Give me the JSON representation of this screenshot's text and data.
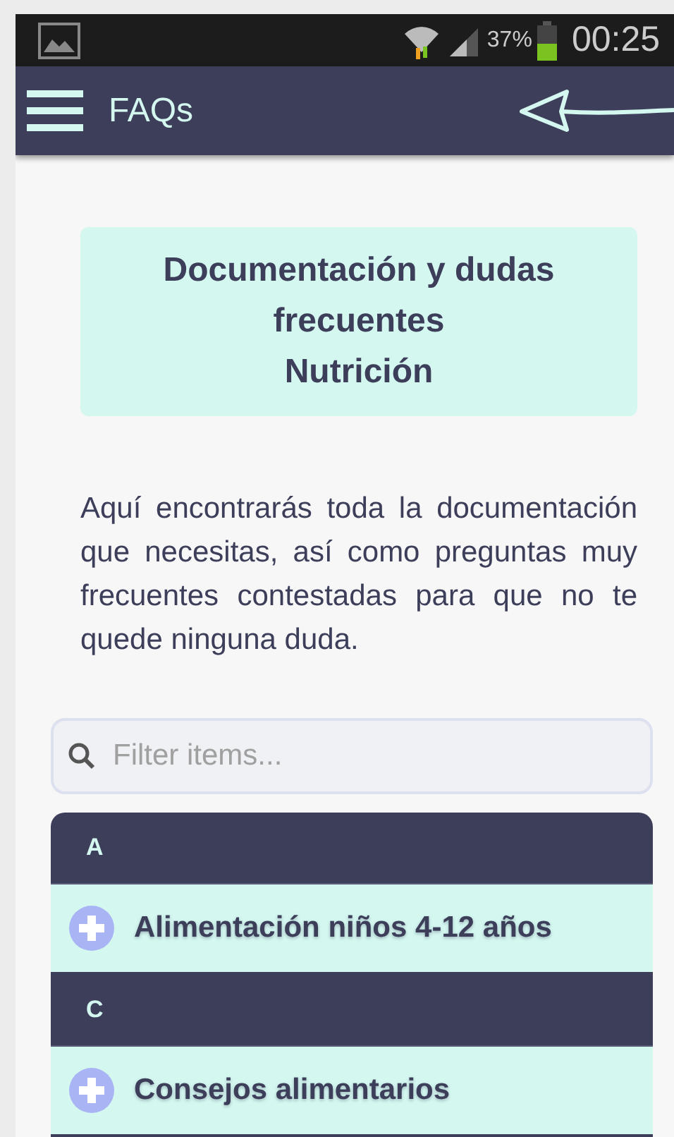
{
  "status_bar": {
    "battery": "37%",
    "time": "00:25"
  },
  "app_bar": {
    "title": "FAQs"
  },
  "intro_card": {
    "lines": [
      "Documentación y dudas frecuentes",
      "Nutrición"
    ]
  },
  "description": "Aquí encontrarás toda la documentación que necesitas, así como preguntas muy frecuentes contestadas para que no te quede ninguna duda.",
  "search": {
    "placeholder": "Filter items..."
  },
  "list": [
    {
      "kind": "header",
      "label": "A"
    },
    {
      "kind": "item",
      "label": "Alimentación niños 4-12 años"
    },
    {
      "kind": "header",
      "label": "C"
    },
    {
      "kind": "item",
      "label": "Consejos alimentarios"
    }
  ]
}
